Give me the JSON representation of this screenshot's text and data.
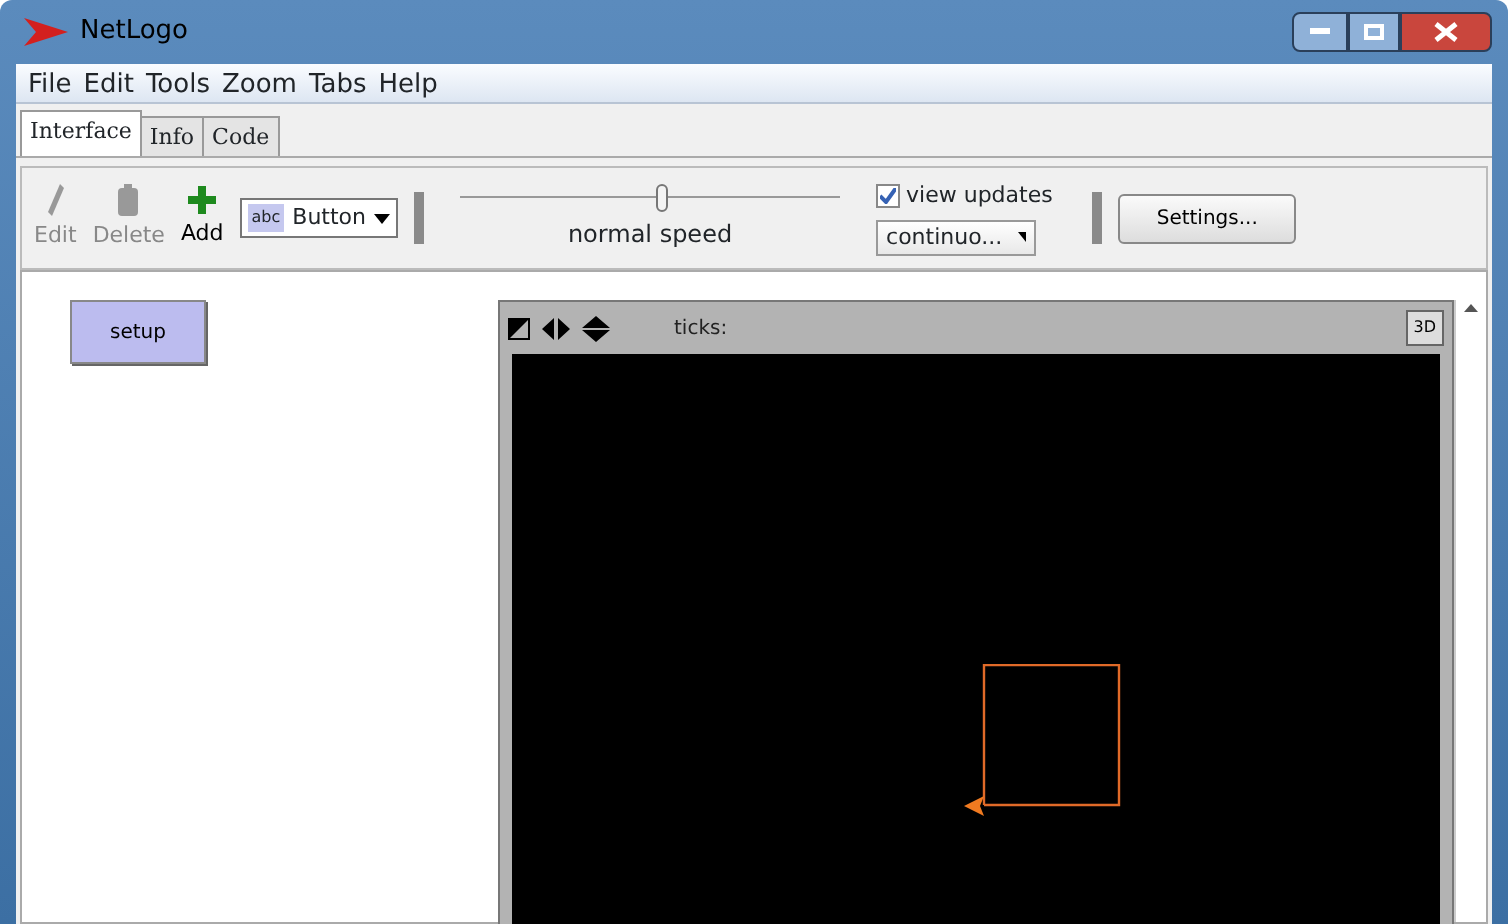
{
  "window": {
    "title": "NetLogo"
  },
  "menu": [
    "File",
    "Edit",
    "Tools",
    "Zoom",
    "Tabs",
    "Help"
  ],
  "tabs": [
    {
      "label": "Interface",
      "selected": true
    },
    {
      "label": "Info",
      "selected": false
    },
    {
      "label": "Code",
      "selected": false
    }
  ],
  "toolbar": {
    "tools": [
      {
        "kind": "edit",
        "label": "Edit",
        "disabled": true
      },
      {
        "kind": "delete",
        "label": "Delete",
        "disabled": true
      },
      {
        "kind": "add",
        "label": "Add",
        "disabled": false
      }
    ],
    "widget_chooser": {
      "icon_text": "abc",
      "value": "Button"
    },
    "speed": {
      "level": 0.53,
      "label": "normal speed"
    },
    "view_updates": {
      "label": "view updates",
      "checked": true
    },
    "update_mode": {
      "value": "continuo..."
    },
    "settings_button": "Settings..."
  },
  "interface": {
    "buttons": [
      {
        "label": "setup"
      }
    ],
    "view": {
      "ticks_label": "ticks:",
      "three_d_button": "3D"
    }
  }
}
